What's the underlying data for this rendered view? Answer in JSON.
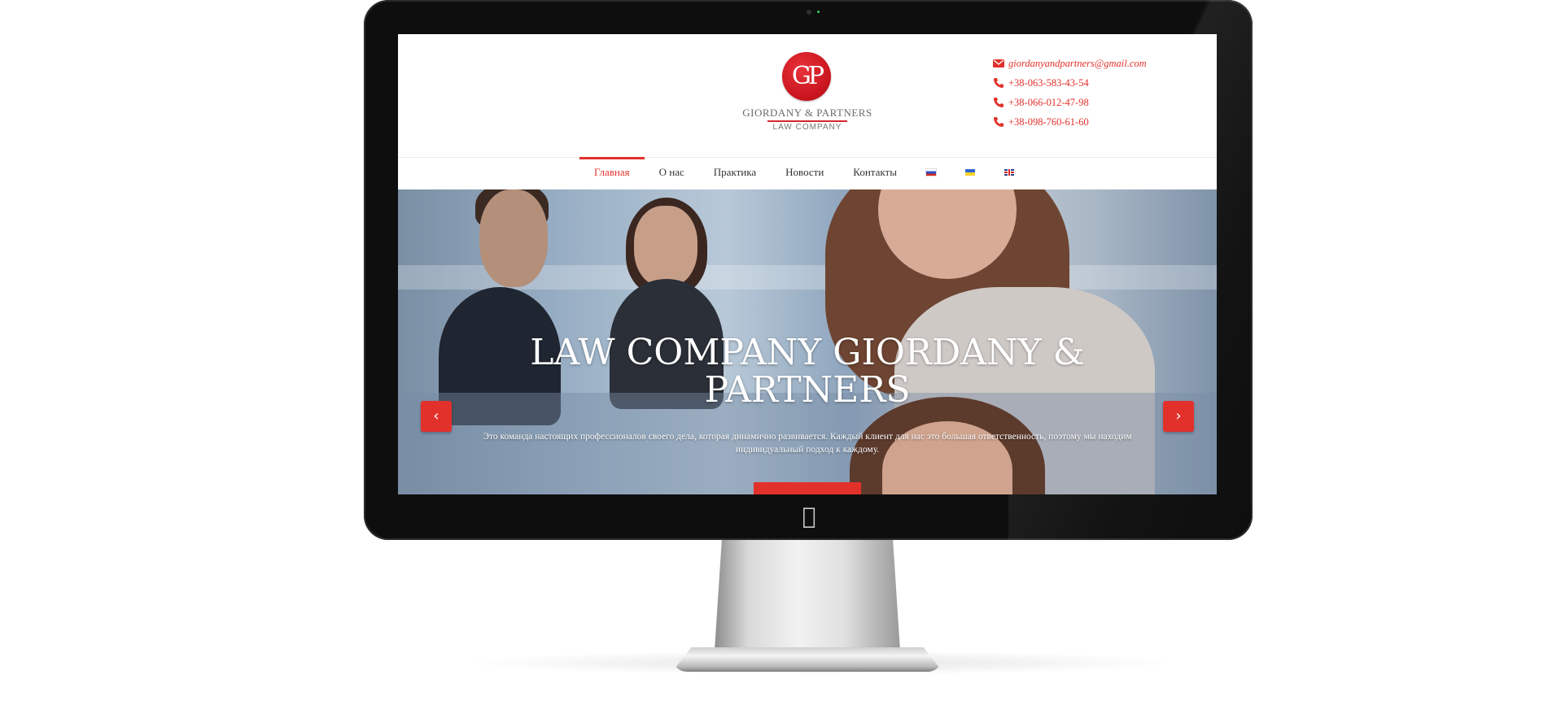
{
  "site": {
    "logo": {
      "monogram": "GP",
      "name": "GIORDANY & PARTNERS",
      "subtitle": "LAW  COMPANY"
    },
    "contacts": [
      {
        "type": "email",
        "icon": "mail-icon",
        "text": "giordanyandpartners@gmail.com"
      },
      {
        "type": "phone",
        "icon": "phone-icon",
        "text": "+38-063-583-43-54"
      },
      {
        "type": "phone",
        "icon": "phone-icon",
        "text": "+38-066-012-47-98"
      },
      {
        "type": "phone",
        "icon": "phone-icon",
        "text": "+38-098-760-61-60"
      }
    ],
    "nav": [
      {
        "label": "Главная",
        "active": true
      },
      {
        "label": "О нас",
        "active": false
      },
      {
        "label": "Практика",
        "active": false
      },
      {
        "label": "Новости",
        "active": false
      },
      {
        "label": "Контакты",
        "active": false
      }
    ],
    "languages": [
      {
        "code": "ru",
        "icon": "flag-ru-icon"
      },
      {
        "code": "ua",
        "icon": "flag-ua-icon"
      },
      {
        "code": "en",
        "icon": "flag-en-icon"
      }
    ],
    "hero": {
      "title": "LAW COMPANY GIORDANY & PARTNERS",
      "text": "Это команда настоящих профессионалов своего дела, которая динамично развивается. Каждый клиент для нас это большая ответственность, поэтому мы находим индивидуальный подход к каждому.",
      "prev_icon": "‹",
      "next_icon": "›"
    },
    "colors": {
      "accent": "#e2312b",
      "text": "#333333",
      "bezel": "#0e0e0e"
    }
  }
}
